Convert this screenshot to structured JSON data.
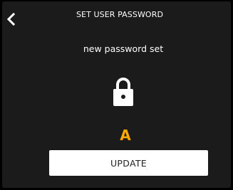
{
  "header": {
    "back_icon": "chevron-left-icon",
    "title": "SET USER PASSWORD"
  },
  "main": {
    "status_text": "new password set",
    "lock_icon": "lock-icon",
    "option_letter": "A",
    "update_label": "UPDATE"
  },
  "colors": {
    "background": "#1b1b1b",
    "text": "#ffffff",
    "accent": "#ffaa00",
    "button_bg": "#ffffff",
    "button_text": "#222222"
  }
}
